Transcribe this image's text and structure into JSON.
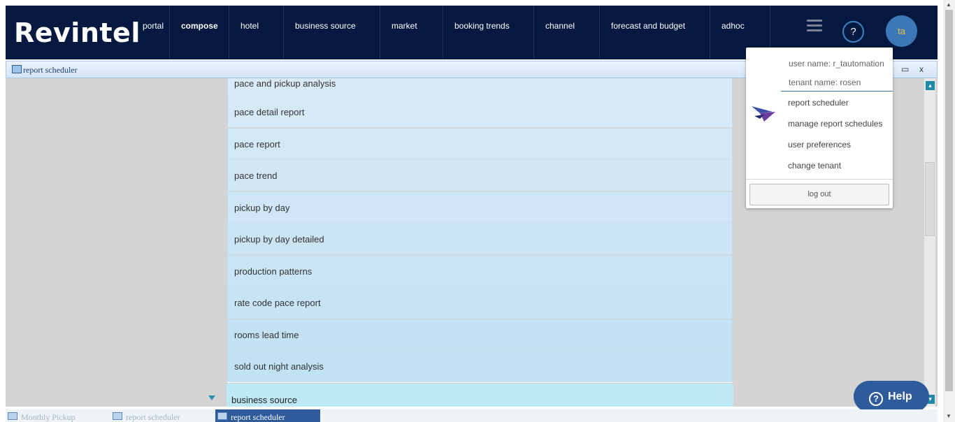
{
  "header": {
    "brand": "Revintel",
    "nav": [
      {
        "label": "portal",
        "bold": false
      },
      {
        "label": "compose",
        "bold": true
      },
      {
        "label": "hotel",
        "bold": false
      },
      {
        "label": "business source",
        "bold": false
      },
      {
        "label": "market",
        "bold": false
      },
      {
        "label": "booking trends",
        "bold": false
      },
      {
        "label": "channel",
        "bold": false
      },
      {
        "label": "forecast and budget",
        "bold": false
      },
      {
        "label": "adhoc",
        "bold": false
      }
    ],
    "help_symbol": "?",
    "avatar_initials": "ta",
    "menu_icon": "hamburger-icon"
  },
  "window": {
    "title": "report scheduler",
    "minimize_symbol": "—",
    "maximize_symbol": "▭",
    "close_symbol": "x"
  },
  "report_list": {
    "items": [
      "pace and pickup analysis",
      "pace detail report",
      "pace report",
      "pace trend",
      "pickup by day",
      "pickup by day detailed",
      "production patterns",
      "rate code pace report",
      "rooms lead time",
      "sold out night analysis"
    ],
    "section": "business source"
  },
  "user_menu": {
    "user_name": "user name: r_tautomation",
    "tenant_name": "tenant name: rosen",
    "items": [
      "report scheduler",
      "manage report schedules",
      "user preferences",
      "change tenant"
    ],
    "logout": "log out",
    "logo_icon": "bird-logo-icon"
  },
  "help_button": {
    "label": "Help",
    "symbol": "?"
  },
  "taskbar": {
    "tabs": [
      {
        "label": "Monthly Pickup",
        "active": false
      },
      {
        "label": "report scheduler",
        "active": false
      },
      {
        "label": "report scheduler",
        "active": true
      }
    ]
  },
  "colors": {
    "nav_bg": "#041840",
    "accent": "#2e5b9b",
    "list_top": "#d7eaf7",
    "list_bottom": "#bfe3f3",
    "section_bg": "#bde9f4"
  }
}
